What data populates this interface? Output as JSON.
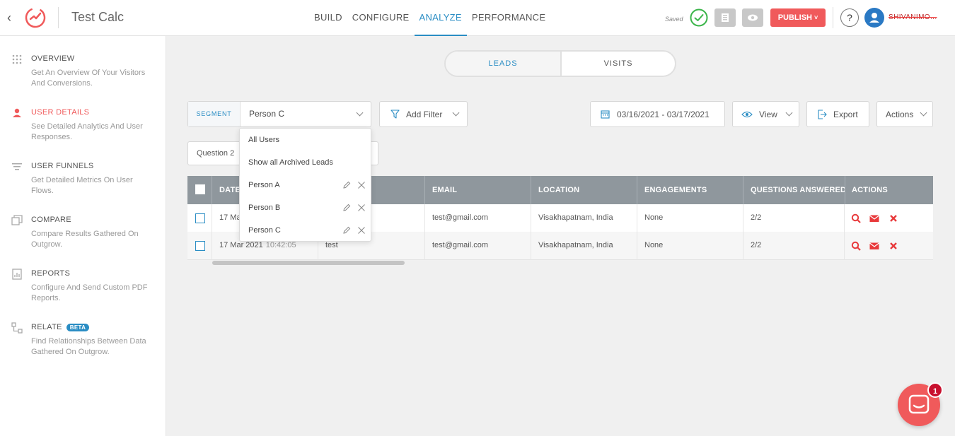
{
  "header": {
    "back_icon": "chevron-left-icon",
    "app_title": "Test Calc",
    "nav": [
      {
        "label": "BUILD",
        "active": false
      },
      {
        "label": "CONFIGURE",
        "active": false
      },
      {
        "label": "ANALYZE",
        "active": true
      },
      {
        "label": "PERFORMANCE",
        "active": false
      }
    ],
    "saved_label": "Saved",
    "publish_label": "PUBLISH",
    "help_label": "?",
    "username": "SHIVANIMO..."
  },
  "sidebar": {
    "items": [
      {
        "title": "OVERVIEW",
        "desc": "Get An Overview Of Your Visitors And Conversions.",
        "icon": "grid-icon",
        "active": false
      },
      {
        "title": "USER DETAILS",
        "desc": "See Detailed Analytics And User Responses.",
        "icon": "user-icon",
        "active": true
      },
      {
        "title": "USER FUNNELS",
        "desc": "Get Detailed Metrics On User Flows.",
        "icon": "funnel-icon",
        "active": false
      },
      {
        "title": "COMPARE",
        "desc": "Compare Results Gathered On Outgrow.",
        "icon": "compare-icon",
        "active": false
      },
      {
        "title": "REPORTS",
        "desc": "Configure And Send Custom PDF Reports.",
        "icon": "report-icon",
        "active": false
      },
      {
        "title": "RELATE",
        "desc": "Find Relationships Between Data Gathered On Outgrow.",
        "icon": "relate-icon",
        "active": false,
        "badge": "BETA"
      }
    ]
  },
  "toggle": {
    "leads": "LEADS",
    "visits": "VISITS"
  },
  "controls": {
    "segment_label": "SEGMENT",
    "segment_value": "Person C",
    "add_filter": "Add Filter",
    "date_range": "03/16/2021 - 03/17/2021",
    "view": "View",
    "export": "Export",
    "actions": "Actions",
    "question_chip": "Question 2"
  },
  "dropdown": {
    "items": [
      {
        "label": "All Users",
        "editable": false
      },
      {
        "label": "Show all Archived Leads",
        "editable": false
      },
      {
        "label": "Person A",
        "editable": true
      },
      {
        "label": "Person B",
        "editable": true
      },
      {
        "label": "Person C",
        "editable": true
      }
    ]
  },
  "table": {
    "columns": [
      "DATE",
      "EMAIL",
      "LOCATION",
      "ENGAGEMENTS",
      "QUESTIONS ANSWERED",
      "ACTIONS"
    ],
    "rows": [
      {
        "date": "17 Ma",
        "time": "",
        "name": "",
        "email": "test@gmail.com",
        "location": "Visakhapatnam, India",
        "engagements": "None",
        "questions": "2/2"
      },
      {
        "date": "17 Mar 2021",
        "time": "10:42:05",
        "name": "test",
        "email": "test@gmail.com",
        "location": "Visakhapatnam, India",
        "engagements": "None",
        "questions": "2/2"
      }
    ]
  },
  "chat": {
    "badge": "1"
  },
  "colors": {
    "accent": "#2a8dc4",
    "brand_red": "#f05a5b",
    "success": "#3bb54a"
  }
}
